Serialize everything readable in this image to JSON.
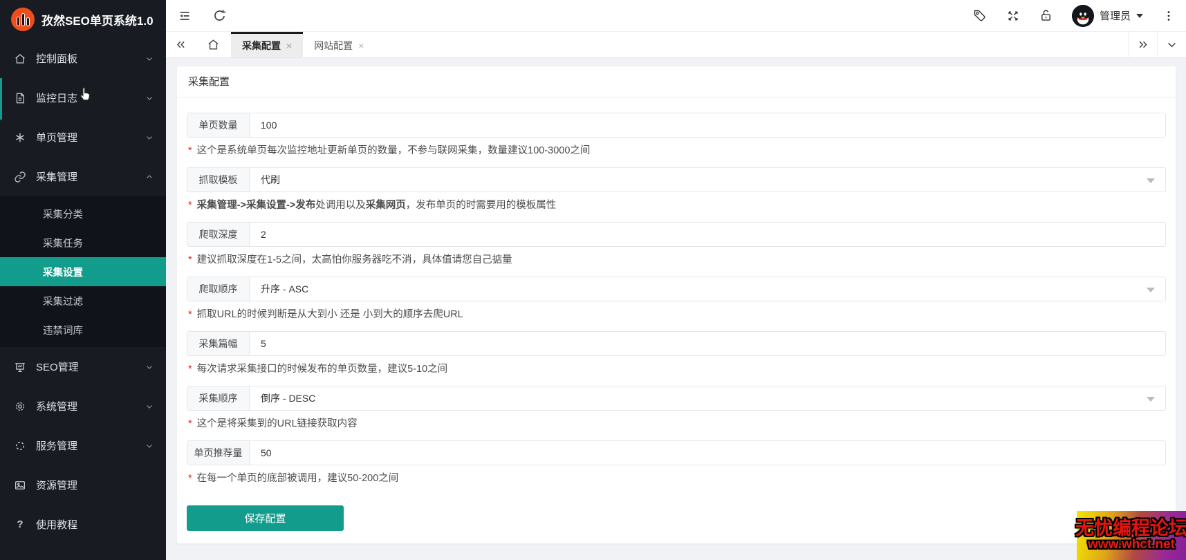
{
  "app": {
    "title": "孜然SEO单页系统1.0"
  },
  "header": {
    "user_label": "管理员"
  },
  "sidebar": {
    "items": [
      {
        "label": "控制面板"
      },
      {
        "label": "监控日志"
      },
      {
        "label": "单页管理"
      },
      {
        "label": "采集管理"
      },
      {
        "label": "SEO管理"
      },
      {
        "label": "系统管理"
      },
      {
        "label": "服务管理"
      },
      {
        "label": "资源管理"
      },
      {
        "label": "使用教程"
      }
    ],
    "collect_children": [
      {
        "label": "采集分类"
      },
      {
        "label": "采集任务"
      },
      {
        "label": "采集设置"
      },
      {
        "label": "采集过滤"
      },
      {
        "label": "违禁词库"
      }
    ]
  },
  "tabbar": {
    "tabs": [
      {
        "label": "采集配置"
      },
      {
        "label": "网站配置"
      }
    ],
    "close_glyph": "×"
  },
  "form": {
    "title": "采集配置",
    "required_marker": "*",
    "save_label": "保存配置",
    "fields": [
      {
        "label": "单页数量",
        "value": "100",
        "hint": "这个是系统单页每次监控地址更新单页的数量，不参与联网采集，数量建议100-3000之间"
      },
      {
        "label": "抓取模板",
        "value": "代刷",
        "hint_bold1": "采集管理->采集设置->发布",
        "hint_mid": "处调用以及",
        "hint_bold2": "采集网页",
        "hint_tail": "，发布单页的时需要用的模板属性"
      },
      {
        "label": "爬取深度",
        "value": "2",
        "hint": "建议抓取深度在1-5之间，太高怕你服务器吃不消，具体值请您自己掂量"
      },
      {
        "label": "爬取顺序",
        "value": "升序 - ASC",
        "hint": "抓取URL的时候判断是从大到小 还是 小到大的顺序去爬URL"
      },
      {
        "label": "采集篇幅",
        "value": "5",
        "hint": "每次请求采集接口的时候发布的单页数量，建议5-10之间"
      },
      {
        "label": "采集顺序",
        "value": "倒序 - DESC",
        "hint": "这个是将采集到的URL链接获取内容"
      },
      {
        "label": "单页推荐量",
        "value": "50",
        "hint": "在每一个单页的底部被调用，建议50-200之间"
      }
    ]
  },
  "watermark": {
    "line1": "无忧编程论坛",
    "line2": "www.whct.net"
  },
  "colors": {
    "accent": "#129c8c",
    "logo_orange": "#ee4e1e",
    "sidebar_bg": "#181b22"
  }
}
